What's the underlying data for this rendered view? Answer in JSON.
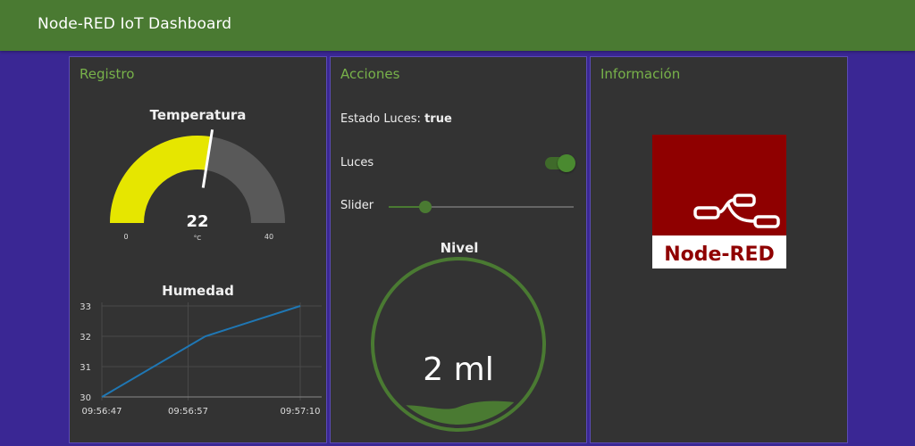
{
  "header": {
    "title": "Node-RED IoT Dashboard"
  },
  "colors": {
    "header_bg": "#4a7a32",
    "page_bg": "#3a2794",
    "card_bg": "#333333",
    "accent_green": "#78b24a",
    "gauge_fill": "#e6e600",
    "gauge_rest": "#595959",
    "line_color": "#1f77b4",
    "nodered_red": "#8f0000"
  },
  "groups": {
    "registro": {
      "title": "Registro",
      "gauge": {
        "title": "Temperatura",
        "value": "22",
        "units": "°C",
        "min_label": "0",
        "max_label": "40",
        "min": 0,
        "max": 40,
        "current": 22
      },
      "chart": {
        "title": "Humedad"
      }
    },
    "acciones": {
      "title": "Acciones",
      "estado_label": "Estado Luces:",
      "estado_value": "true",
      "luces_label": "Luces",
      "luces_on": true,
      "slider_label": "Slider",
      "slider_value_fraction": 0.2,
      "nivel": {
        "title": "Nivel",
        "value_text": "2 ml",
        "level_fraction": 0.12
      }
    },
    "informacion": {
      "title": "Información",
      "logo_text": "Node-RED"
    }
  },
  "chart_data": {
    "type": "line",
    "title": "Humedad",
    "xlabel": "",
    "ylabel": "",
    "x_tick_labels": [
      "09:56:47",
      "09:56:57",
      "09:57:10"
    ],
    "y_tick_labels": [
      "33",
      "32",
      "31",
      "30"
    ],
    "ylim": [
      30,
      33
    ],
    "grid": true,
    "series": [
      {
        "x": [
          "09:56:47",
          "09:56:59",
          "09:57:10"
        ],
        "values": [
          30,
          32,
          33
        ]
      }
    ]
  }
}
